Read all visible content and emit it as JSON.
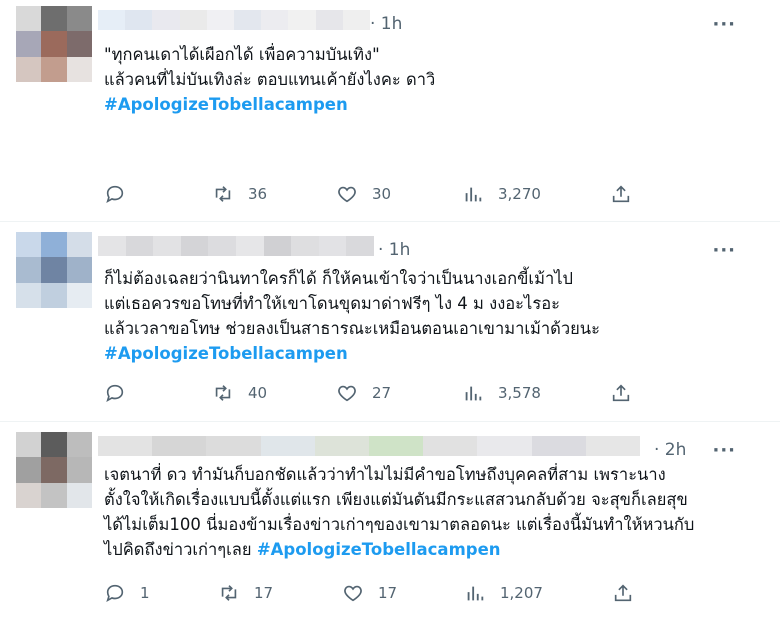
{
  "tweets": [
    {
      "time": "· 1h",
      "more_label": "···",
      "lines": [
        "\"ทุกคนเดาได้เผือกได้ เพื่อความบันเทิง\"",
        "",
        "แล้วคนที่ไม่บันเทิงล่ะ ตอบแทนเค้ายังไงคะ ดาวิ",
        ""
      ],
      "hashtag": "#ApologizeTobellacampen",
      "reply_count": "",
      "retweet_count": "36",
      "like_count": "30",
      "view_count": "3,270",
      "avatar_colors": [
        "#d9d9d9",
        "#6e6e6e",
        "#8a8a8a",
        "#a7a7b7",
        "#9b6a5c",
        "#7d6b6b",
        "#d5c6c0",
        "#c29d8e",
        "#e7e2e0"
      ],
      "name_colors": [
        "#e6eef7",
        "#dfe6f0",
        "#e9e9ef",
        "#eaeaea",
        "#f0f0f3",
        "#e3e7ee",
        "#ececf0",
        "#f1f1f1",
        "#e6e6ea",
        "#efefef"
      ]
    },
    {
      "time": "· 1h",
      "more_label": "···",
      "lines": [
        "ก็ไม่ต้องเฉลยว่านินทาใครก็ได้ ก็ให้คนเข้าใจว่าเป็นนางเอกขี้เม้าไป",
        "แต่เธอควรขอโทษที่ทำให้เขาโดนขุดมาด่าฟรีๆ ไง 4 ม งงอะไรอะ",
        "แล้วเวลาขอโทษ ช่วยลงเป็นสาธารณะเหมือนตอนเอาเขามาเม้าด้วยนะ"
      ],
      "hashtag": "#ApologizeTobellacampen",
      "reply_count": "",
      "retweet_count": "40",
      "like_count": "27",
      "view_count": "3,578",
      "avatar_colors": [
        "#c9d8ea",
        "#8fb0d8",
        "#d4dde8",
        "#a9bbd0",
        "#6f84a3",
        "#9fb2c9",
        "#d6e0ea",
        "#c0cfdf",
        "#e6ecf2"
      ],
      "name_colors": [
        "#e4e4e6",
        "#d8d8db",
        "#e2e2e4",
        "#d4d4d7",
        "#dcdcdf",
        "#e6e6e8",
        "#d0d0d3",
        "#dedee0",
        "#e2e2e5",
        "#d9d9dc"
      ]
    },
    {
      "time": "· 2h",
      "more_label": "···",
      "lines": [
        "เจตนาที่ ดว ทำมันก็บอกชัดแล้วว่าทำไมไม่มีคำขอโทษถึงบุคคลที่สาม เพราะนาง",
        "ตั้งใจให้เกิดเรื่องแบบนี้ตั้งแต่แรก เพียงแต่มันดันมีกระแสสวนกลับด้วย จะสุขก็เลยสุข",
        "ได้ไม่เต็ม100 นี่มองข้ามเรื่องข่าวเก่าๆของเขามาตลอดนะ แต่เรื่องนี้มันทำให้หวนกับ",
        "ไปคิดถึงข่าวเก่าๆเลย  "
      ],
      "hashtag": "#ApologizeTobellacampen",
      "reply_count": "1",
      "retweet_count": "17",
      "like_count": "17",
      "view_count": "1,207",
      "avatar_colors": [
        "#d2d2d2",
        "#5c5c5c",
        "#bdbdbd",
        "#a0a0a0",
        "#7d6963",
        "#b7b7b7",
        "#d9d3d0",
        "#c3c3c3",
        "#e2e6ea"
      ],
      "name_colors": [
        "#e3e3e3",
        "#d6d6d6",
        "#dcdcdc",
        "#e0e6ea",
        "#dde3d9",
        "#cfe3c7",
        "#e1e1e1",
        "#e9e9ec",
        "#dbdbe0",
        "#e6e6e6"
      ]
    }
  ]
}
